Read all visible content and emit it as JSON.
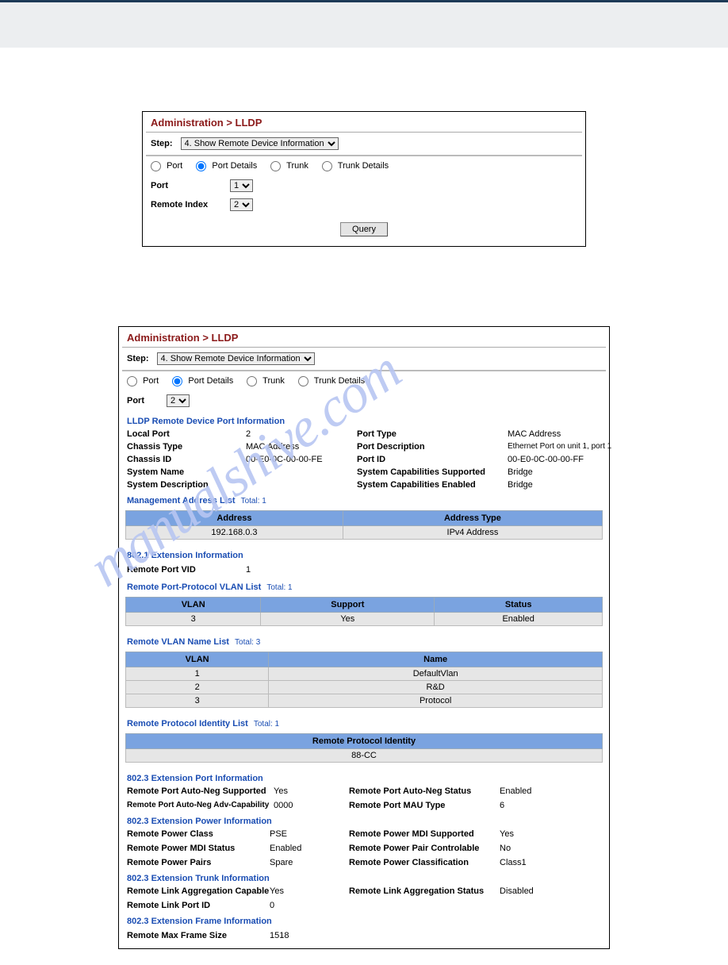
{
  "watermark": "manualshive.com",
  "panel1": {
    "title": "Administration > LLDP",
    "step_label": "Step:",
    "step_value": "4. Show Remote Device Information",
    "radios": {
      "port": "Port",
      "port_details": "Port Details",
      "trunk": "Trunk",
      "trunk_details": "Trunk Details",
      "selected": "port_details"
    },
    "port_label": "Port",
    "port_value": "1",
    "remote_index_label": "Remote Index",
    "remote_index_value": "2",
    "query_btn": "Query"
  },
  "panel2": {
    "title": "Administration > LLDP",
    "step_label": "Step:",
    "step_value": "4. Show Remote Device Information",
    "radios": {
      "port": "Port",
      "port_details": "Port Details",
      "trunk": "Trunk",
      "trunk_details": "Trunk Details",
      "selected": "port_details"
    },
    "port_label": "Port",
    "port_value": "2",
    "remote_port_info": {
      "title": "LLDP Remote Device Port Information",
      "rows": [
        {
          "k1": "Local Port",
          "v1": "2",
          "k2": "Port Type",
          "v2": "MAC Address"
        },
        {
          "k1": "Chassis Type",
          "v1": "MAC Address",
          "k2": "Port Description",
          "v2": "Ethernet Port on unit 1, port 1"
        },
        {
          "k1": "Chassis ID",
          "v1": "00-E0-0C-00-00-FE",
          "k2": "Port ID",
          "v2": "00-E0-0C-00-00-FF"
        },
        {
          "k1": "System Name",
          "v1": "",
          "k2": "System Capabilities Supported",
          "v2": "Bridge"
        },
        {
          "k1": "System Description",
          "v1": "",
          "k2": "System Capabilities Enabled",
          "v2": "Bridge"
        }
      ]
    },
    "mgmt_addr": {
      "title": "Management Address List",
      "total": "Total: 1",
      "headers": [
        "Address",
        "Address Type"
      ],
      "rows": [
        [
          "192.168.0.3",
          "IPv4 Address"
        ]
      ]
    },
    "ext_8021": {
      "title": "802.1 Extension Information",
      "remote_port_vid_label": "Remote Port VID",
      "remote_port_vid_value": "1"
    },
    "pp_vlan": {
      "title": "Remote Port-Protocol VLAN List",
      "total": "Total: 1",
      "headers": [
        "VLAN",
        "Support",
        "Status"
      ],
      "rows": [
        [
          "3",
          "Yes",
          "Enabled"
        ]
      ]
    },
    "vlan_name": {
      "title": "Remote VLAN Name List",
      "total": "Total: 3",
      "headers": [
        "VLAN",
        "Name"
      ],
      "rows": [
        [
          "1",
          "DefaultVlan"
        ],
        [
          "2",
          "R&D"
        ],
        [
          "3",
          "Protocol"
        ]
      ]
    },
    "proto_id": {
      "title": "Remote Protocol Identity List",
      "total": "Total: 1",
      "headers": [
        "Remote Protocol Identity"
      ],
      "rows": [
        [
          "88-CC"
        ]
      ]
    },
    "ext_8023_port": {
      "title": "802.3 Extension Port Information",
      "rows": [
        {
          "k1": "Remote Port Auto-Neg Supported",
          "v1": "Yes",
          "k2": "Remote Port Auto-Neg Status",
          "v2": "Enabled"
        },
        {
          "k1": "Remote Port Auto-Neg Adv-Capability",
          "v1": "0000",
          "k2": "Remote Port MAU Type",
          "v2": "6"
        }
      ]
    },
    "ext_8023_power": {
      "title": "802.3 Extension Power Information",
      "rows": [
        {
          "k1": "Remote Power Class",
          "v1": "PSE",
          "k2": "Remote Power MDI Supported",
          "v2": "Yes"
        },
        {
          "k1": "Remote Power MDI Status",
          "v1": "Enabled",
          "k2": "Remote Power Pair Controlable",
          "v2": "No"
        },
        {
          "k1": "Remote Power Pairs",
          "v1": "Spare",
          "k2": "Remote Power Classification",
          "v2": "Class1"
        }
      ]
    },
    "ext_8023_trunk": {
      "title": "802.3 Extension Trunk Information",
      "rows": [
        {
          "k1": "Remote Link Aggregation Capable",
          "v1": "Yes",
          "k2": "Remote Link Aggregation Status",
          "v2": "Disabled"
        },
        {
          "k1": "Remote Link Port ID",
          "v1": "0",
          "k2": "",
          "v2": ""
        }
      ]
    },
    "ext_8023_frame": {
      "title": "802.3 Extension Frame Information",
      "label": "Remote Max Frame Size",
      "value": "1518"
    }
  }
}
